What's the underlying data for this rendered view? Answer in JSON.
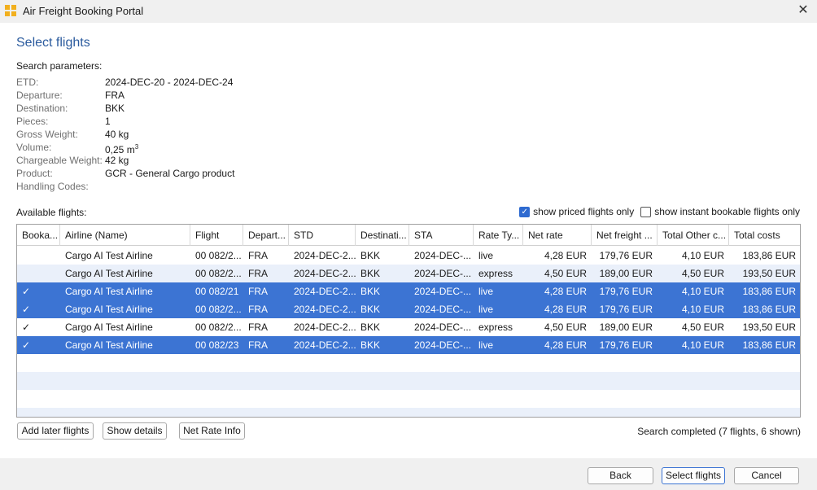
{
  "window": {
    "title": "Air Freight Booking Portal"
  },
  "page": {
    "title": "Select flights"
  },
  "search_params": {
    "heading": "Search parameters:",
    "rows": [
      {
        "label": "ETD:",
        "value": "2024-DEC-20 - 2024-DEC-24"
      },
      {
        "label": "Departure:",
        "value": "FRA"
      },
      {
        "label": "Destination:",
        "value": "BKK"
      },
      {
        "label": "Pieces:",
        "value": "1"
      },
      {
        "label": "Gross Weight:",
        "value": "40 kg"
      },
      {
        "label": "Volume:",
        "value": "0,25 m",
        "sup": "3"
      },
      {
        "label": "Chargeable Weight:",
        "value": "42 kg"
      },
      {
        "label": "Product:",
        "value": "GCR - General Cargo product"
      },
      {
        "label": "Handling Codes:",
        "value": ""
      }
    ]
  },
  "flights": {
    "label": "Available flights:",
    "show_priced_only": {
      "label": "show priced flights only",
      "checked": true
    },
    "show_instant_only": {
      "label": "show instant bookable flights only",
      "checked": false
    },
    "columns": [
      "Booka...",
      "Airline (Name)",
      "Flight",
      "Depart...",
      "STD",
      "Destinati...",
      "STA",
      "Rate Ty...",
      "Net rate",
      "Net freight ...",
      "Total Other c...",
      "Total costs"
    ],
    "rows": [
      {
        "selected": false,
        "cells": [
          "",
          "Cargo AI Test Airline",
          "00 082/2...",
          "FRA",
          "2024-DEC-2...",
          "BKK",
          "2024-DEC-...",
          "live",
          "4,28 EUR",
          "179,76 EUR",
          "4,10 EUR",
          "183,86 EUR"
        ]
      },
      {
        "selected": false,
        "cells": [
          "",
          "Cargo AI Test Airline",
          "00 082/2...",
          "FRA",
          "2024-DEC-2...",
          "BKK",
          "2024-DEC-...",
          "express",
          "4,50 EUR",
          "189,00 EUR",
          "4,50 EUR",
          "193,50 EUR"
        ]
      },
      {
        "selected": true,
        "cells": [
          "✓",
          "Cargo AI Test Airline",
          "00 082/21",
          "FRA",
          "2024-DEC-2...",
          "BKK",
          "2024-DEC-...",
          "live",
          "4,28 EUR",
          "179,76 EUR",
          "4,10 EUR",
          "183,86 EUR"
        ]
      },
      {
        "selected": true,
        "cells": [
          "✓",
          "Cargo AI Test Airline",
          "00 082/2...",
          "FRA",
          "2024-DEC-2...",
          "BKK",
          "2024-DEC-...",
          "live",
          "4,28 EUR",
          "179,76 EUR",
          "4,10 EUR",
          "183,86 EUR"
        ]
      },
      {
        "selected": false,
        "cells": [
          "✓",
          "Cargo AI Test Airline",
          "00 082/2...",
          "FRA",
          "2024-DEC-2...",
          "BKK",
          "2024-DEC-...",
          "express",
          "4,50 EUR",
          "189,00 EUR",
          "4,50 EUR",
          "193,50 EUR"
        ]
      },
      {
        "selected": true,
        "cells": [
          "✓",
          "Cargo AI Test Airline",
          "00 082/23",
          "FRA",
          "2024-DEC-2...",
          "BKK",
          "2024-DEC-...",
          "live",
          "4,28 EUR",
          "179,76 EUR",
          "4,10 EUR",
          "183,86 EUR"
        ]
      }
    ]
  },
  "actions": {
    "add_later": "Add later flights",
    "show_details": "Show details",
    "net_rate_info": "Net Rate Info"
  },
  "status": "Search completed (7 flights, 6 shown)",
  "footer": {
    "back": "Back",
    "select": "Select flights",
    "cancel": "Cancel"
  },
  "icons": {
    "app": "app-logo-icon",
    "close": "close-icon",
    "check": "checkmark-icon"
  },
  "colors": {
    "title_blue": "#2b5b9e",
    "selection": "#3c74d3",
    "alt_row": "#eaf0fa"
  }
}
